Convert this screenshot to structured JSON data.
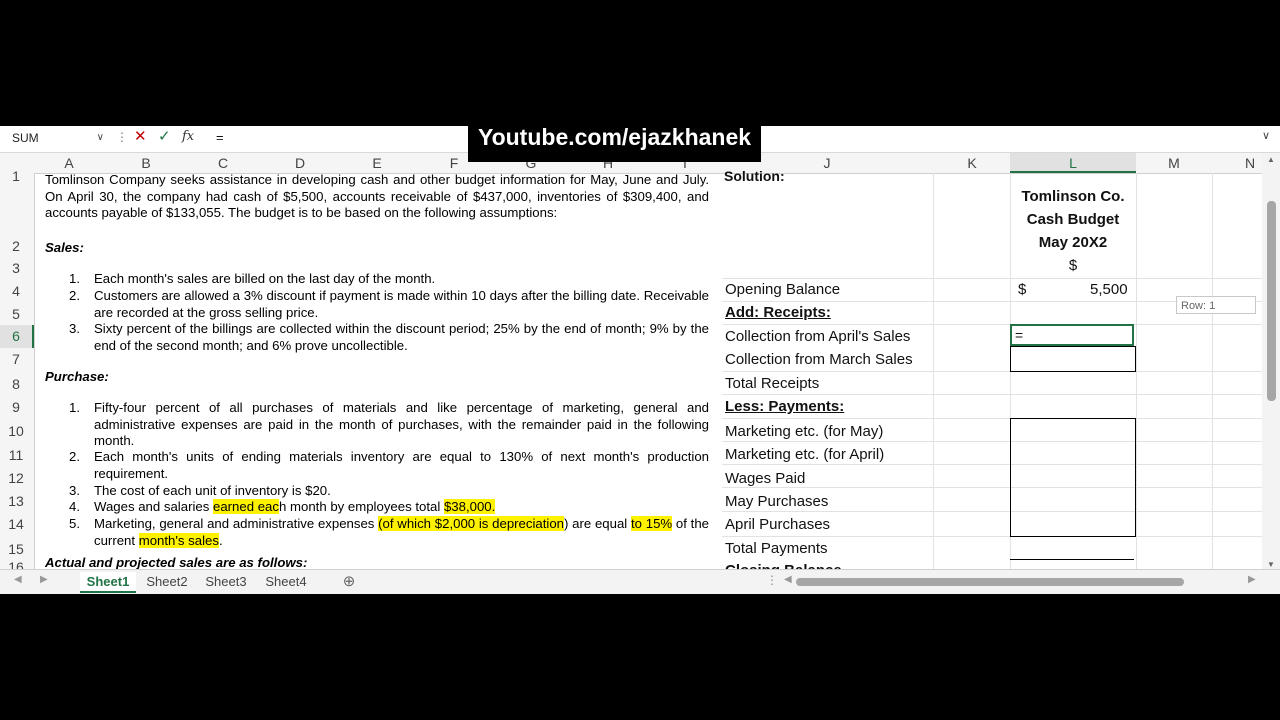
{
  "formula_bar": {
    "name_box": "SUM",
    "formula": "="
  },
  "watermark": "Youtube.com/ejazkhanek",
  "columns": [
    "A",
    "B",
    "C",
    "D",
    "E",
    "F",
    "G",
    "H",
    "I",
    "J",
    "K",
    "L",
    "M",
    "N"
  ],
  "rows": [
    "1",
    "2",
    "3",
    "4",
    "5",
    "6",
    "7",
    "8",
    "9",
    "10",
    "11",
    "12",
    "13",
    "14",
    "15",
    "16"
  ],
  "problem": {
    "intro": "Tomlinson Company seeks assistance in developing cash and other budget information for May, June and July. On April 30, the company had cash of $5,500, accounts receivable of $437,000, inventories of $309,400, and accounts payable of $133,055. The budget is to be based on the following assumptions:",
    "sales_heading": "Sales:",
    "sales_items": [
      {
        "num": "1.",
        "text": "Each month's sales are billed on the last day of the month."
      },
      {
        "num": "2.",
        "text": "Customers are allowed a 3% discount if payment is made within 10 days after the billing date. Receivable are recorded at the gross selling price."
      },
      {
        "num": "3.",
        "text": "Sixty percent of the billings are collected within the discount period; 25% by the end of month; 9% by the end of the second month; and 6% prove uncollectible."
      }
    ],
    "purchases_heading": "Purchase:",
    "purchase_items": [
      {
        "num": "1.",
        "text": "Fifty-four percent of all purchases of materials and like percentage of marketing, general and administrative expenses are paid in the month of purchases, with the remainder paid in the following month."
      },
      {
        "num": "2.",
        "text": "Each month's units of ending materials inventory are equal to 130% of next month's production requirement."
      },
      {
        "num": "3.",
        "text": "The cost of each unit of inventory is $20."
      }
    ],
    "item4": {
      "num": "4.",
      "a": "Wages and salaries ",
      "b": "earned eac",
      "c": "h month by employees total ",
      "d": "$38,000."
    },
    "item5": {
      "num": "5.",
      "a": "Marketing, general and administrative expenses ",
      "b": "(of which $2,000 is depreciation",
      "c": ") are equal ",
      "d": "to 15%",
      "e": "of the current ",
      "f": "month's sales",
      "g": "."
    },
    "actual_heading": "Actual and projected sales are as follows:"
  },
  "solution": {
    "label": "Solution:",
    "company": "Tomlinson Co.",
    "statement": "Cash Budget",
    "period": "May 20X2",
    "currency": "$",
    "opening_balance_label": "Opening Balance",
    "opening_currency": "$",
    "opening_balance_value": "5,500",
    "add_receipts": "Add: Receipts:",
    "collection_april": "Collection from April's Sales",
    "collection_march": "Collection from March Sales",
    "total_receipts": "Total Receipts",
    "less_payments": "Less: Payments:",
    "marketing_may": "Marketing etc. (for May)",
    "marketing_april": "Marketing etc. (for April)",
    "wages": "Wages Paid",
    "may_purchases": "May Purchases",
    "april_purchases": "April Purchases",
    "total_payments": "Total Payments",
    "closing_balance": "Closing Balance",
    "active_cell_value": "="
  },
  "tooltip": "Row: 1",
  "sheets": [
    "Sheet1",
    "Sheet2",
    "Sheet3",
    "Sheet4"
  ]
}
